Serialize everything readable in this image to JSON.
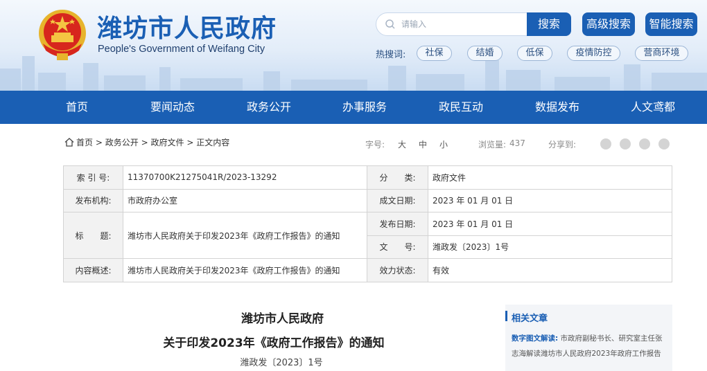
{
  "header": {
    "title": "潍坊市人民政府",
    "subtitle": "People's Government of Weifang City",
    "search_placeholder": "请输入",
    "search_button": "搜索",
    "advanced_search": "高级搜索",
    "smart_search": "智能搜索",
    "hot_label": "热搜词:",
    "hot_words": [
      "社保",
      "结婚",
      "低保",
      "疫情防控",
      "营商环境"
    ]
  },
  "nav": [
    "首页",
    "要闻动态",
    "政务公开",
    "办事服务",
    "政民互动",
    "数据发布",
    "人文鸢都"
  ],
  "breadcrumb": [
    "首页",
    "政务公开",
    "政府文件",
    "正文内容"
  ],
  "breadcrumb_sep": ">",
  "tools": {
    "font_size_label": "字号:",
    "sizes": [
      "大",
      "中",
      "小"
    ],
    "views_label": "浏览量:",
    "views": "437",
    "share_label": "分享到:"
  },
  "info": {
    "index_label": "索 引 号:",
    "index": "11370700K21275041R/2023-13292",
    "category_label": "分　　类:",
    "category": "政府文件",
    "issuer_label": "发布机构:",
    "issuer": "市政府办公室",
    "created_label": "成文日期:",
    "created": "2023 年 01 月 01 日",
    "title_label": "标　　题:",
    "title": "潍坊市人民政府关于印发2023年《政府工作报告》的通知",
    "published_label": "发布日期:",
    "published": "2023 年 01 月 01 日",
    "docno_label": "文　　号:",
    "docno": "潍政发〔2023〕1号",
    "summary_label": "内容概述:",
    "summary": "潍坊市人民政府关于印发2023年《政府工作报告》的通知",
    "status_label": "效力状态:",
    "status": "有效"
  },
  "article": {
    "issuer": "潍坊市人民政府",
    "title": "关于印发2023年《政府工作报告》的通知",
    "docno": "潍政发〔2023〕1号"
  },
  "related": {
    "heading": "相关文章",
    "keyword": "数字图文解读:",
    "text": "市政府副秘书长、研究室主任张志海解读潍坊市人民政府2023年政府工作报告"
  }
}
